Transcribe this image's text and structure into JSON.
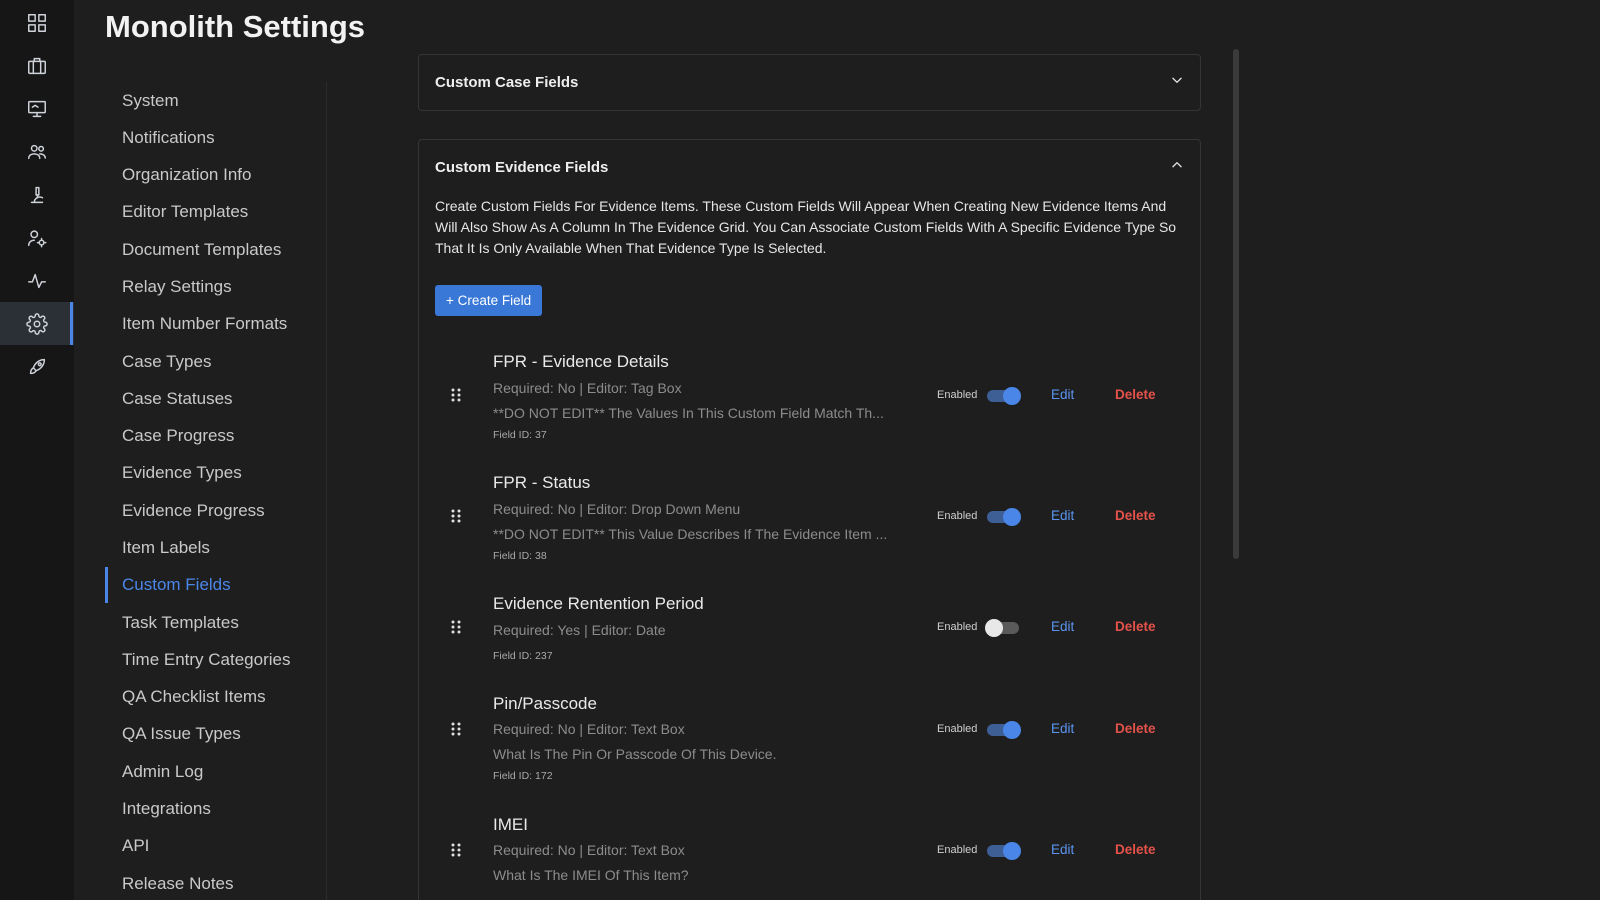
{
  "page_title": "Monolith Settings",
  "rail": {
    "items": [
      {
        "icon": "dashboard-grid-icon"
      },
      {
        "icon": "briefcase-icon"
      },
      {
        "icon": "monitor-icon"
      },
      {
        "icon": "users-icon"
      },
      {
        "icon": "microscope-icon"
      },
      {
        "icon": "user-settings-icon"
      },
      {
        "icon": "activity-icon"
      },
      {
        "icon": "gear-icon",
        "active": true
      },
      {
        "icon": "rocket-icon"
      }
    ]
  },
  "settings_nav": {
    "items": [
      "System",
      "Notifications",
      "Organization Info",
      "Editor Templates",
      "Document Templates",
      "Relay Settings",
      "Item Number Formats",
      "Case Types",
      "Case Statuses",
      "Case Progress",
      "Evidence Types",
      "Evidence Progress",
      "Item Labels",
      "Custom Fields",
      "Task Templates",
      "Time Entry Categories",
      "QA Checklist Items",
      "QA Issue Types",
      "Admin Log",
      "Integrations",
      "API",
      "Release Notes"
    ],
    "active": "Custom Fields"
  },
  "case_panel": {
    "title": "Custom Case Fields",
    "expanded": false
  },
  "evidence_panel": {
    "title": "Custom Evidence Fields",
    "expanded": true,
    "description": "Create Custom Fields For Evidence Items. These Custom Fields Will Appear When Creating New Evidence Items And Will Also Show As A Column In The Evidence Grid. You Can Associate Custom Fields With A Specific Evidence Type So That It Is Only Available When That Evidence Type Is Selected.",
    "create_button": "+ Create Field",
    "enabled_label": "Enabled",
    "edit_label": "Edit",
    "delete_label": "Delete",
    "fields": [
      {
        "name": "FPR - Evidence Details",
        "meta": "Required: No | Editor: Tag Box",
        "description": "**DO NOT EDIT** The Values In This Custom Field Match Th...",
        "field_id": "Field ID: 37",
        "enabled": true
      },
      {
        "name": "FPR - Status",
        "meta": "Required: No | Editor: Drop Down Menu",
        "description": "**DO NOT EDIT** This Value Describes If The Evidence Item ...",
        "field_id": "Field ID: 38",
        "enabled": true
      },
      {
        "name": "Evidence Rentention Period",
        "meta": "Required: Yes | Editor: Date",
        "description": "",
        "field_id": "Field ID: 237",
        "enabled": false
      },
      {
        "name": "Pin/Passcode",
        "meta": "Required: No | Editor: Text Box",
        "description": "What Is The Pin Or Passcode Of This Device.",
        "field_id": "Field ID: 172",
        "enabled": true
      },
      {
        "name": "IMEI",
        "meta": "Required: No | Editor: Text Box",
        "description": "What Is The IMEI Of This Item?",
        "field_id": "",
        "enabled": true
      }
    ]
  },
  "colors": {
    "accent": "#4a86e8",
    "delete": "#e5524a",
    "background": "#1e1e1e",
    "rail": "#161616"
  }
}
